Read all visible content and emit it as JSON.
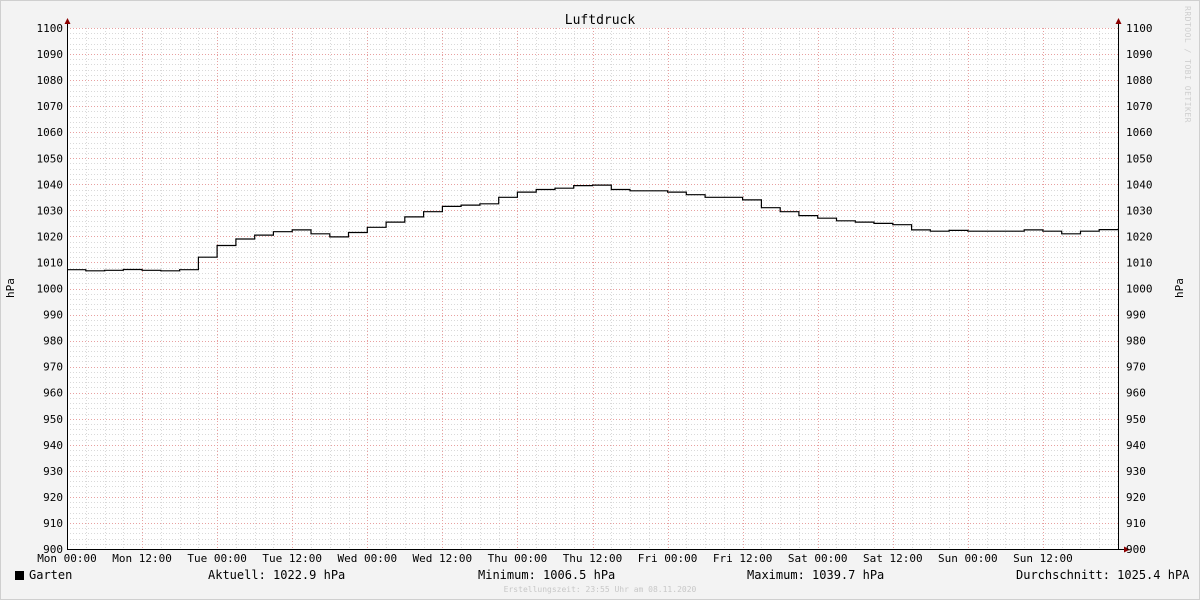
{
  "chart_data": {
    "type": "line",
    "title": "Luftdruck",
    "ylabel": "hPa",
    "ylabel_right": "hPa",
    "ylim": [
      900,
      1100
    ],
    "y_ticks": [
      900,
      910,
      920,
      930,
      940,
      950,
      960,
      970,
      980,
      990,
      1000,
      1010,
      1020,
      1030,
      1040,
      1050,
      1060,
      1070,
      1080,
      1090,
      1100
    ],
    "x_tick_labels": [
      "Mon 00:00",
      "Mon 12:00",
      "Tue 00:00",
      "Tue 12:00",
      "Wed 00:00",
      "Wed 12:00",
      "Thu 00:00",
      "Thu 12:00",
      "Fri 00:00",
      "Fri 12:00",
      "Sat 00:00",
      "Sat 12:00",
      "Sun 00:00",
      "Sun 12:00"
    ],
    "x_range_hours": [
      0,
      168
    ],
    "grid": true,
    "legend_position": "bottom-left",
    "series": [
      {
        "name": "Garten",
        "color": "#000000",
        "x_hours": [
          0,
          3,
          6,
          9,
          12,
          15,
          18,
          21,
          24,
          27,
          30,
          33,
          36,
          39,
          42,
          45,
          48,
          51,
          54,
          57,
          60,
          63,
          66,
          69,
          72,
          75,
          78,
          81,
          84,
          87,
          90,
          93,
          96,
          99,
          102,
          105,
          108,
          111,
          114,
          117,
          120,
          123,
          126,
          129,
          132,
          135,
          138,
          141,
          144,
          147,
          150,
          153,
          156,
          159,
          162,
          165,
          168
        ],
        "values": [
          1007.2,
          1006.8,
          1007.0,
          1007.3,
          1007.0,
          1006.8,
          1007.2,
          1012.0,
          1016.5,
          1019.0,
          1020.5,
          1021.8,
          1022.5,
          1021.0,
          1019.8,
          1021.5,
          1023.5,
          1025.5,
          1027.5,
          1029.5,
          1031.5,
          1032.0,
          1032.5,
          1035.0,
          1037.0,
          1038.0,
          1038.5,
          1039.5,
          1039.7,
          1038.0,
          1037.5,
          1037.5,
          1037.0,
          1036.0,
          1035.0,
          1035.0,
          1034.0,
          1031.0,
          1029.5,
          1028.0,
          1027.0,
          1026.0,
          1025.5,
          1025.0,
          1024.5,
          1022.5,
          1022.0,
          1022.3,
          1022.0,
          1022.0,
          1022.0,
          1022.5,
          1022.0,
          1021.0,
          1022.0,
          1022.6,
          1022.9
        ]
      }
    ]
  },
  "legend": {
    "series_name": "Garten",
    "current": "Aktuell: 1022.9 hPa",
    "minimum": "Minimum: 1006.5 hPa",
    "maximum": "Maximum: 1039.7 hPa",
    "average": "Durchschnitt: 1025.4 hPA"
  },
  "footer": "Erstellungszeit: 23:55 Uhr am 08.11.2020",
  "watermark": "RRDTOOL / TOBI OETIKER"
}
